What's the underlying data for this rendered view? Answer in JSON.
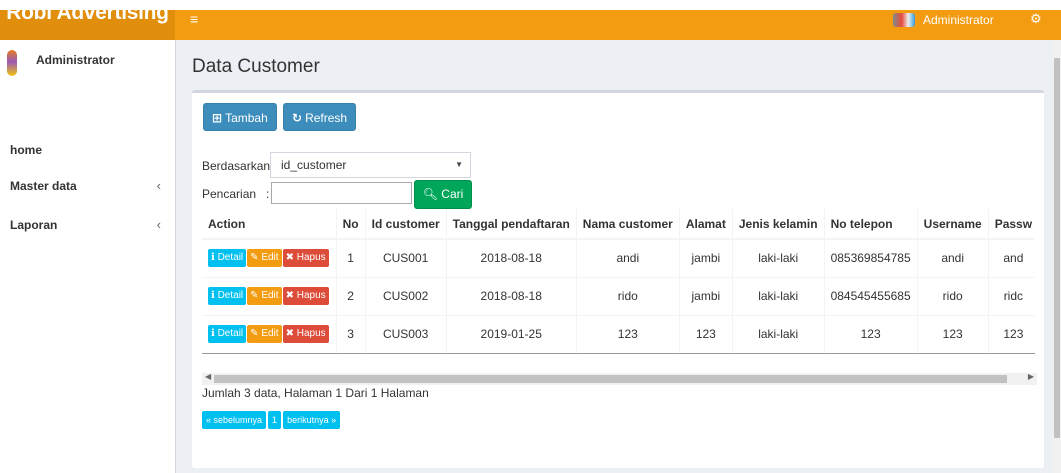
{
  "header": {
    "app_name": "Robi Advertising",
    "toggle_icon": "≡",
    "user_label": "Administrator",
    "gear_icon": "⚙"
  },
  "sidebar": {
    "user_name": "Administrator",
    "items": [
      {
        "label": "home",
        "chevron": ""
      },
      {
        "label": "Master data",
        "chevron": "‹"
      },
      {
        "label": "Laporan",
        "chevron": "‹"
      }
    ]
  },
  "page": {
    "title": "Data Customer"
  },
  "toolbar": {
    "add_label": "Tambah",
    "refresh_label": "Refresh",
    "add_icon": "plus-square-icon",
    "refresh_icon": "refresh-icon"
  },
  "filter": {
    "by_label": "Berdasarkan:",
    "by_value": "id_customer",
    "search_label": "Pencarian",
    "search_colon": ":",
    "search_value": "",
    "search_button": "Cari"
  },
  "table": {
    "columns": [
      "Action",
      "No",
      "Id customer",
      "Tanggal pendaftaran",
      "Nama customer",
      "Alamat",
      "Jenis kelamin",
      "No telepon",
      "Username",
      "Passw"
    ],
    "action_labels": {
      "detail": "Detail",
      "edit": "Edit",
      "delete": "Hapus"
    },
    "rows": [
      {
        "no": "1",
        "id": "CUS001",
        "date": "2018-08-18",
        "name": "andi",
        "address": "jambi",
        "gender": "laki-laki",
        "phone": "085369854785",
        "username": "andi",
        "password": "and"
      },
      {
        "no": "2",
        "id": "CUS002",
        "date": "2018-08-18",
        "name": "rido",
        "address": "jambi",
        "gender": "laki-laki",
        "phone": "084545455685",
        "username": "rido",
        "password": "ridc"
      },
      {
        "no": "3",
        "id": "CUS003",
        "date": "2019-01-25",
        "name": "123",
        "address": "123",
        "gender": "laki-laki",
        "phone": "123",
        "username": "123",
        "password": "123"
      }
    ]
  },
  "footer": {
    "summary": "Jumlah 3 data, Halaman 1 Dari 1 Halaman",
    "prev": "« sebelumnya",
    "page": "1",
    "next": "berikutnya »"
  },
  "colors": {
    "header": "#f39c12",
    "primary": "#3c8dbc",
    "success": "#00a65a",
    "info": "#00c0ef",
    "warning": "#f39c12",
    "danger": "#dd4b39"
  }
}
